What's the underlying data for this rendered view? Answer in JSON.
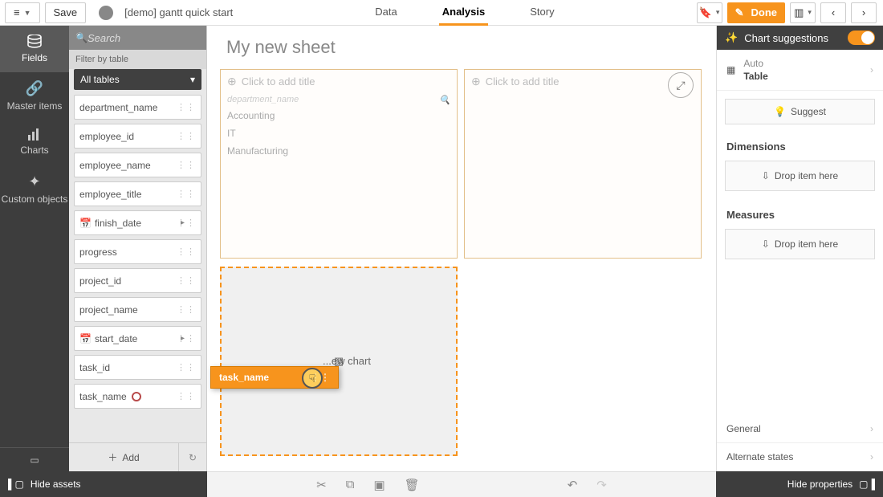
{
  "topbar": {
    "save": "Save",
    "app_title": "[demo] gantt quick start",
    "tabs": {
      "data": "Data",
      "analysis": "Analysis",
      "story": "Story"
    },
    "done": "Done"
  },
  "vnav": {
    "fields": "Fields",
    "master": "Master items",
    "charts": "Charts",
    "custom": "Custom objects"
  },
  "fields_panel": {
    "search_placeholder": "Search",
    "filter_label": "Filter by table",
    "tables": "All tables",
    "fields": {
      "f0": "department_name",
      "f1": "employee_id",
      "f2": "employee_name",
      "f3": "employee_title",
      "f4": "finish_date",
      "f5": "progress",
      "f6": "project_id",
      "f7": "project_name",
      "f8": "start_date",
      "f9": "task_id",
      "f10": "task_name"
    },
    "add": "Add"
  },
  "canvas": {
    "sheet_title": "My new sheet",
    "add_title": "Click to add title",
    "col1": "department_name",
    "rows": {
      "r0": "Accounting",
      "r1": "IT",
      "r2": "Manufacturing"
    },
    "drop_label": "Drop to create a new chart",
    "drag_label": "task_name"
  },
  "rpanel": {
    "head": "Chart suggestions",
    "auto": "Auto",
    "table": "Table",
    "suggest": "Suggest",
    "dimensions": "Dimensions",
    "measures": "Measures",
    "drop_here": "Drop item here",
    "general": "General",
    "alt": "Alternate states"
  },
  "bottom": {
    "hide_assets": "Hide assets",
    "hide_props": "Hide properties"
  }
}
